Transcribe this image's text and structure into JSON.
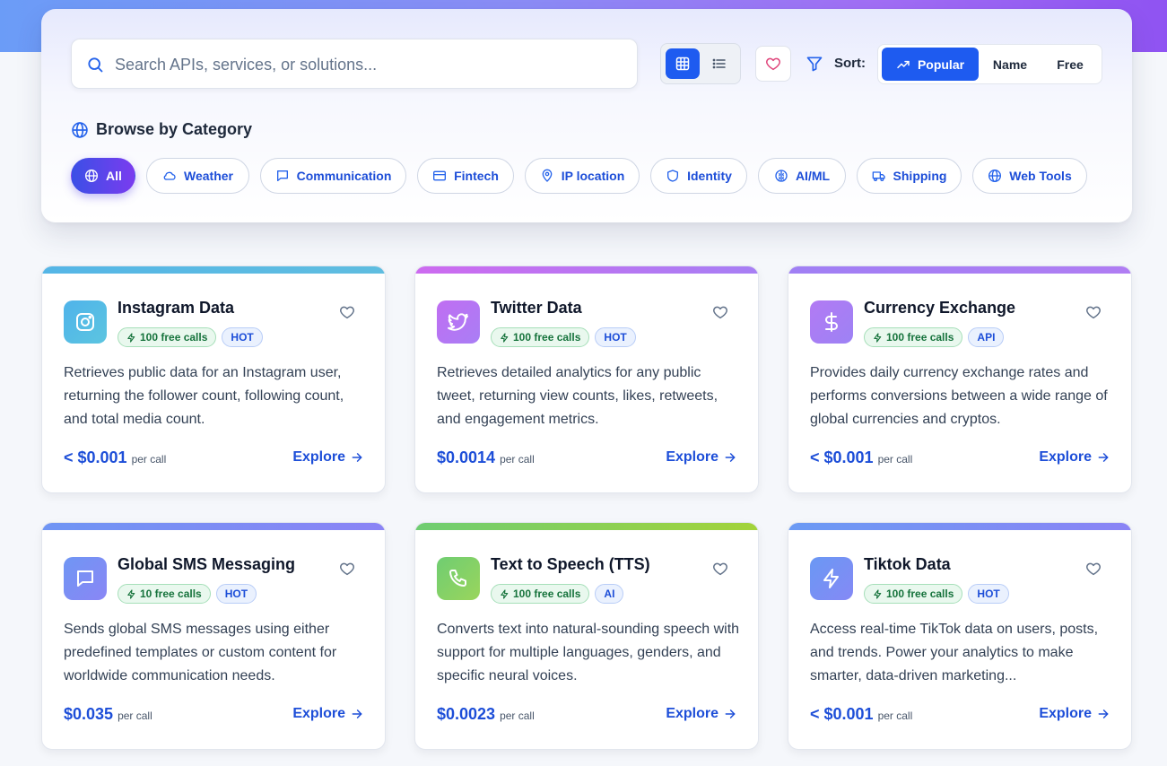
{
  "search": {
    "placeholder": "Search APIs, services, or solutions..."
  },
  "toolbar": {
    "sort_label": "Sort:",
    "sort_options": [
      {
        "label": "Popular",
        "active": true
      },
      {
        "label": "Name",
        "active": false
      },
      {
        "label": "Free",
        "active": false
      }
    ],
    "view_mode": "grid"
  },
  "browse": {
    "title": "Browse by Category",
    "categories": [
      {
        "label": "All",
        "icon": "globe-icon",
        "active": true
      },
      {
        "label": "Weather",
        "icon": "cloud-icon",
        "active": false
      },
      {
        "label": "Communication",
        "icon": "message-icon",
        "active": false
      },
      {
        "label": "Fintech",
        "icon": "credit-card-icon",
        "active": false
      },
      {
        "label": "IP location",
        "icon": "map-pin-icon",
        "active": false
      },
      {
        "label": "Identity",
        "icon": "shield-icon",
        "active": false
      },
      {
        "label": "AI/ML",
        "icon": "brain-icon",
        "active": false
      },
      {
        "label": "Shipping",
        "icon": "truck-icon",
        "active": false
      },
      {
        "label": "Web Tools",
        "icon": "globe-icon",
        "active": false
      }
    ]
  },
  "cards": [
    {
      "title": "Instagram Data",
      "icon": "instagram-icon",
      "free_calls": "100 free calls",
      "tag": "HOT",
      "description": "Retrieves public data for an Instagram user, returning the follower count, following count, and total media count.",
      "price": "< $0.001",
      "price_unit": "per call",
      "explore": "Explore",
      "accent": "#55b6e6"
    },
    {
      "title": "Twitter Data",
      "icon": "twitter-icon",
      "free_calls": "100 free calls",
      "tag": "HOT",
      "description": "Retrieves detailed analytics for any public tweet, returning view counts, likes, retweets, and engagement metrics.",
      "price": "$0.0014",
      "price_unit": "per call",
      "explore": "Explore",
      "accent": "#b86ef3"
    },
    {
      "title": "Currency Exchange",
      "icon": "dollar-icon",
      "free_calls": "100 free calls",
      "tag": "API",
      "description": "Provides daily currency exchange rates and performs conversions between a wide range of global currencies and cryptos.",
      "price": "< $0.001",
      "price_unit": "per call",
      "explore": "Explore",
      "accent": "#a07ff4"
    },
    {
      "title": "Global SMS Messaging",
      "icon": "message-icon",
      "free_calls": "10 free calls",
      "tag": "HOT",
      "description": "Sends global SMS messages using either predefined templates or custom content for worldwide communication needs.",
      "price": "$0.035",
      "price_unit": "per call",
      "explore": "Explore",
      "accent": "#7b8ef5"
    },
    {
      "title": "Text to Speech (TTS)",
      "icon": "phone-icon",
      "free_calls": "100 free calls",
      "tag": "AI",
      "description": "Converts text into natural-sounding speech with support for multiple languages, genders, and specific neural voices.",
      "price": "$0.0023",
      "price_unit": "per call",
      "explore": "Explore",
      "accent": "#7fcf66"
    },
    {
      "title": "Tiktok Data",
      "icon": "lightning-icon",
      "free_calls": "100 free calls",
      "tag": "HOT",
      "description": "Access real-time TikTok data on users, posts, and trends. Power your analytics to make smarter, data-driven marketing...",
      "price": "< $0.001",
      "price_unit": "per call",
      "explore": "Explore",
      "accent": "#6f92f4"
    }
  ]
}
